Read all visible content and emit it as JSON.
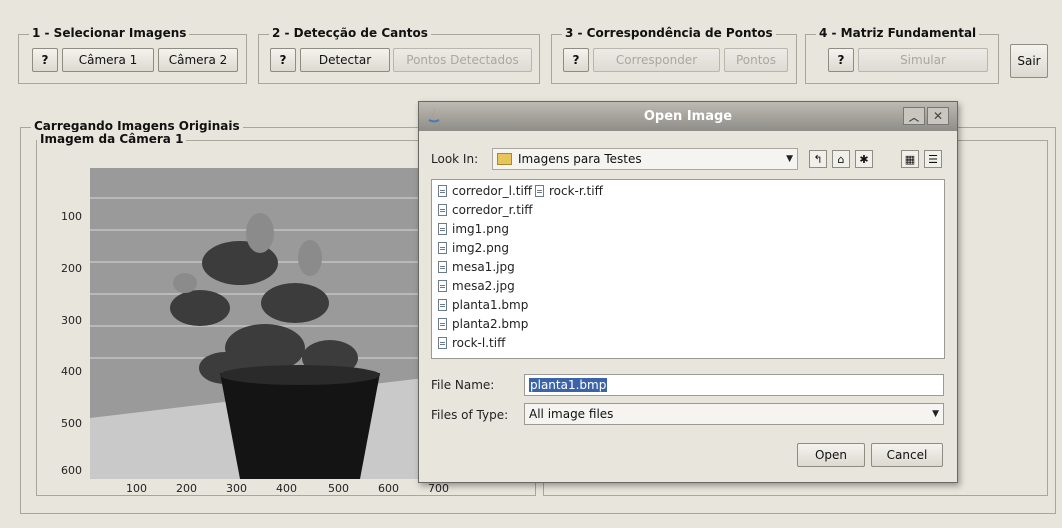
{
  "groups": {
    "g1": {
      "title": "1 - Selecionar Imagens",
      "help": "?",
      "cam1": "Câmera 1",
      "cam2": "Câmera 2"
    },
    "g2": {
      "title": "2 - Detecção de Cantos",
      "help": "?",
      "detect": "Detectar",
      "points": "Pontos Detectados"
    },
    "g3": {
      "title": "3 - Correspondência de Pontos",
      "help": "?",
      "match": "Corresponder",
      "points": "Pontos"
    },
    "g4": {
      "title": "4 - Matriz Fundamental",
      "help": "?",
      "simulate": "Simular"
    },
    "exit": "Sair"
  },
  "panel": {
    "title": "Carregando Imagens Originais",
    "subtitle": "Imagem da Câmera 1"
  },
  "axes": {
    "y_ticks": [
      "100",
      "200",
      "300",
      "400",
      "500",
      "600"
    ],
    "x_ticks": [
      "100",
      "200",
      "300",
      "400",
      "500",
      "600",
      "700"
    ]
  },
  "dialog": {
    "title": "Open Image",
    "look_in_label": "Look In:",
    "look_in_value": "Imagens para Testes",
    "files": [
      "corredor_l.tiff",
      "rock-r.tiff",
      "corredor_r.tiff",
      "img1.png",
      "img2.png",
      "mesa1.jpg",
      "mesa2.jpg",
      "planta1.bmp",
      "planta2.bmp",
      "rock-l.tiff"
    ],
    "file_name_label": "File Name:",
    "file_name_value": "planta1.bmp",
    "files_of_type_label": "Files of Type:",
    "files_of_type_value": "All image files",
    "open": "Open",
    "cancel": "Cancel"
  }
}
